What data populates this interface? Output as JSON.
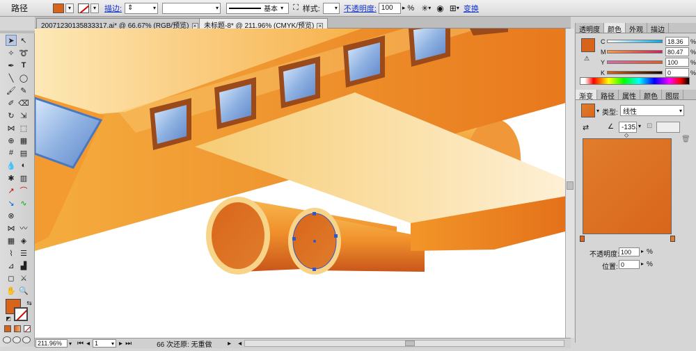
{
  "control_bar": {
    "mode_label": "路径",
    "fill_color": "#d8631a",
    "stroke_link": "描边:",
    "stroke_style_label": "基本",
    "style_label": "样式:",
    "opacity_link": "不透明度:",
    "opacity_value": "100",
    "opacity_unit": "%",
    "transform_link": "变换"
  },
  "doc_tabs": [
    {
      "label": "20071230135833317.ai* @ 66.67% (RGB/预览)",
      "active": false
    },
    {
      "label": "未标题-8* @ 211.96% (CMYK/预览)",
      "active": true
    }
  ],
  "status_bar": {
    "zoom": "211.96%",
    "page": "1",
    "undo_text": "66 次还原: 无重做"
  },
  "color_panel": {
    "tabs": [
      "透明度",
      "颜色",
      "外观",
      "描边"
    ],
    "active_tab": "颜色",
    "channels": [
      {
        "label": "C",
        "value": "18.36",
        "fraction": 0.18
      },
      {
        "label": "M",
        "value": "80.47",
        "fraction": 0.8
      },
      {
        "label": "Y",
        "value": "100",
        "fraction": 1.0
      },
      {
        "label": "K",
        "value": "0",
        "fraction": 0.0
      }
    ],
    "percent_unit": "%"
  },
  "gradient_panel": {
    "tabs": [
      "渐变",
      "路径",
      "属性",
      "颜色",
      "图层"
    ],
    "active_tab": "渐变",
    "type_label": "类型:",
    "type_value": "线性",
    "angle_value": "-135.",
    "opacity_label": "不透明度:",
    "opacity_value": "100",
    "position_label": "位置:",
    "position_value": "0",
    "percent_unit": "%",
    "start_color": "#d9661a",
    "end_color": "#e07d2c"
  },
  "colors": {
    "fill": "#d8631a",
    "panel_bg": "#d6d6d6"
  }
}
